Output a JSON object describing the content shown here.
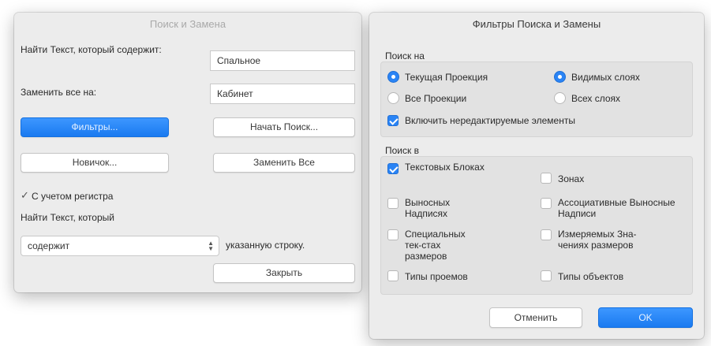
{
  "find_dialog": {
    "title": "Поиск и Замена",
    "find_label": "Найти Текст, который содержит:",
    "find_value": "Спальное",
    "replace_label": "Заменить все на:",
    "replace_value": "Кабинет",
    "filters_button": "Фильтры...",
    "start_search_button": "Начать Поиск...",
    "new_button": "Новичок...",
    "replace_all_button": "Заменить Все",
    "match_case_label": "С учетом регистра",
    "find_text_label2": "Найти Текст, который",
    "condition_value": "содержит",
    "condition_suffix": "указанную строку.",
    "close_button": "Закрыть"
  },
  "filters_dialog": {
    "title": "Фильтры Поиска и Замены",
    "search_on_label": "Поиск на",
    "radio_current_view": "Текущая Проекция",
    "radio_all_views": "Все Проекции",
    "radio_visible_layers": "Видимых слоях",
    "radio_all_layers": "Всех слоях",
    "include_uneditable": "Включить нередактируемые элементы",
    "search_in_label": "Поиск в",
    "opt_text_blocks": "Текстовых Блоках",
    "opt_zones": "Зонах",
    "opt_callouts": "Выносных Надписях",
    "opt_assoc_callouts": "Ассоциативные Выносные Надписи",
    "opt_special_dim_text": "Специальных тек-стах размеров",
    "opt_measured_dim_values": "Измеряемых Зна-чениях размеров",
    "opt_opening_types": "Типы проемов",
    "opt_object_types": "Типы объектов",
    "cancel_button": "Отменить",
    "ok_button": "OK"
  }
}
